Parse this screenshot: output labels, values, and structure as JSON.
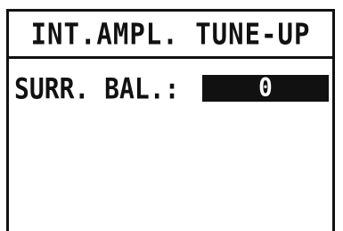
{
  "screen": {
    "title": "INT.AMPL. TUNE-UP"
  },
  "parameter": {
    "label": "SURR. BAL.:",
    "value": "0"
  }
}
